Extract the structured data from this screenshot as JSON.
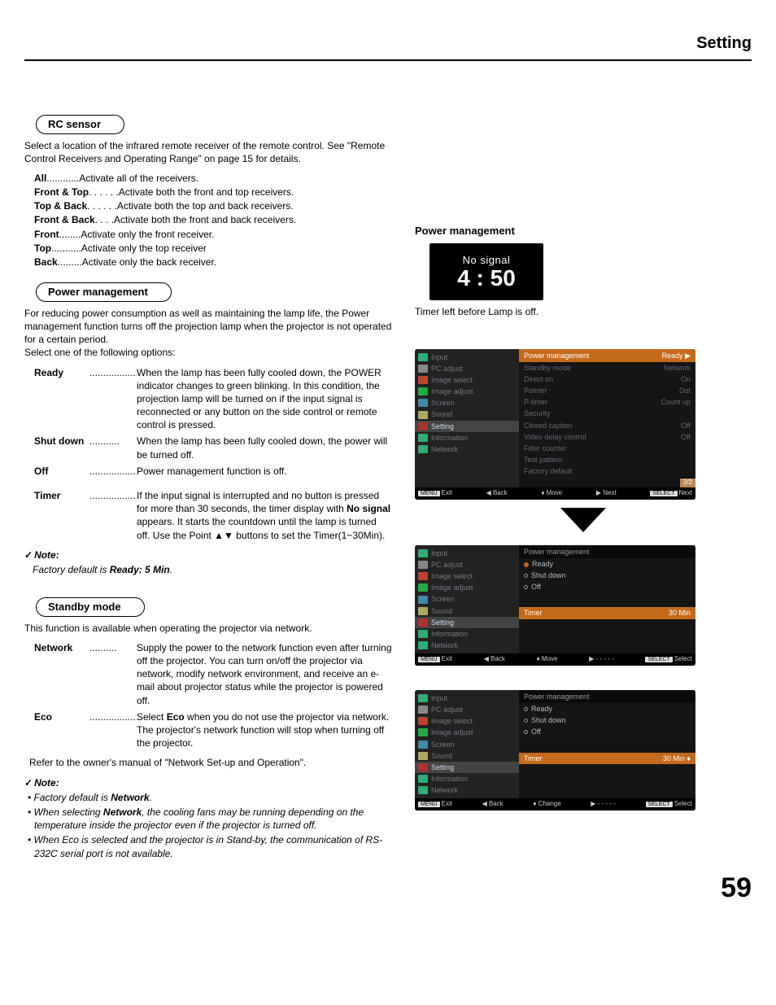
{
  "header": {
    "title": "Setting"
  },
  "page_number": "59",
  "rc_sensor": {
    "heading": "RC sensor",
    "intro": "Select a location of the infrared remote receiver of the remote control. See \"Remote Control Receivers and Operating Range\" on page 15 for details.",
    "options": [
      {
        "term": "All",
        "dots": "............",
        "desc": "Activate all of the receivers."
      },
      {
        "term": "Front & Top",
        "dots": " . . . . . .",
        "desc": "Activate both the front and top receivers."
      },
      {
        "term": "Top & Back",
        "dots": " . . . . . .",
        "desc": "Activate both the top and back receivers."
      },
      {
        "term": "Front & Back",
        "dots": " . . . .",
        "desc": "Activate both the front and back receivers."
      },
      {
        "term": "Front",
        "dots": "........ ",
        "desc": "Activate only the front receiver."
      },
      {
        "term": "Top",
        "dots": "........... ",
        "desc": "Activate only the top receiver"
      },
      {
        "term": "Back",
        "dots": "......... ",
        "desc": "Activate only the back receiver."
      }
    ]
  },
  "power_mgmt": {
    "heading": "Power management",
    "intro": "For reducing power consumption as well as maintaining the lamp life, the Power management function turns off the projection lamp when the projector is not operated for a certain period.\nSelect one of the following options:",
    "defs": [
      {
        "term": "Ready",
        "dots": "..................",
        "desc": "When the lamp has been fully cooled down, the POWER indicator changes to green blinking. In this condition, the projection lamp will be turned on if the input signal is reconnected or any button on the side control or remote control is pressed."
      },
      {
        "term": "Shut down",
        "dots": "...........",
        "desc": "When the lamp has been fully cooled down, the power will be turned off."
      },
      {
        "term": "Off",
        "dots": "........................",
        "desc": "Power management function is off."
      },
      {
        "term": "Timer",
        "dots": "....................",
        "desc_parts": [
          "If the input signal is interrupted and no button is pressed for more than 30 seconds, the timer display with ",
          "No signal",
          " appears. It starts the countdown until the lamp is turned off. Use the Point ▲▼ buttons to set the Timer(1~30Min)."
        ]
      }
    ],
    "note_head": "Note:",
    "note_body_parts": [
      "Factory default is ",
      "Ready: 5 Min",
      "."
    ]
  },
  "standby": {
    "heading": "Standby mode",
    "intro": "This function is available when operating the projector via network.",
    "defs": [
      {
        "term": "Network",
        "dots": "..........",
        "desc": "Supply the power to the network function even after turning off the projector. You can turn on/off the projector via network, modify network environment, and receive an e-mail about projector status while the projector is powered off."
      },
      {
        "term": "Eco",
        "dots": "...................",
        "desc_parts": [
          "Select ",
          "Eco",
          " when you do not use the projector via network. The projector's network function will stop when turning off the projector."
        ]
      }
    ],
    "refer": "Refer to the owner's manual of \"Network Set-up and Operation\".",
    "note_head": "Note:",
    "notes": [
      {
        "parts": [
          "• Factory default is ",
          "Network",
          "."
        ]
      },
      {
        "parts": [
          "• When selecting ",
          "Network",
          ", the cooling fans may be running depending on the temperature inside the projector even if the projector is turned off."
        ]
      },
      {
        "plain": "• When Eco is selected and the projector is in Stand-by, the communication of RS-232C serial port is not available."
      }
    ]
  },
  "right_panel": {
    "title": "Power management",
    "no_signal": "No signal",
    "time": "4 : 50",
    "caption": "Timer left before Lamp is off."
  },
  "menu_side_items": [
    "Input",
    "PC adjust",
    "Image select",
    "Image adjust",
    "Screen",
    "Sound",
    "Setting",
    "Information",
    "Network"
  ],
  "menu_side_colors": [
    "#3a7",
    "#888",
    "#b43",
    "#2a4",
    "#48a",
    "#aa6",
    "#a33",
    "#3a7",
    "#3a7"
  ],
  "shot1": {
    "title": "Power management",
    "title_right": "Ready ▶",
    "rows": [
      {
        "l": "Standby mode",
        "r": "Network"
      },
      {
        "l": "Direct on",
        "r": "On"
      },
      {
        "l": "Pointer",
        "r": "Dot"
      },
      {
        "l": "P-timer",
        "r": "Count up"
      },
      {
        "l": "Security",
        "r": ""
      },
      {
        "l": "Closed caption",
        "r": "Off"
      },
      {
        "l": "Video delay control",
        "r": "Off"
      },
      {
        "l": "Filter counter",
        "r": ""
      },
      {
        "l": "Test pattern",
        "r": ""
      },
      {
        "l": "Factory default",
        "r": ""
      }
    ],
    "page_tag": "2/2",
    "foot": [
      "Exit",
      "◀ Back",
      "♦ Move",
      "▶ Next",
      "Next"
    ]
  },
  "shot2": {
    "title": "Power management",
    "opts": [
      "Ready",
      "Shut down",
      "Off"
    ],
    "timer_l": "Timer",
    "timer_r": "30 Min",
    "foot": [
      "Exit",
      "◀ Back",
      "♦ Move",
      "▶ - - - - -",
      "Select"
    ]
  },
  "shot3": {
    "title": "Power management",
    "opts": [
      "Ready",
      "Shut down",
      "Off"
    ],
    "timer_l": "Timer",
    "timer_r": "30 Min ♦",
    "foot": [
      "Exit",
      "◀ Back",
      "♦ Change",
      "▶ - - - - -",
      "Select"
    ]
  }
}
